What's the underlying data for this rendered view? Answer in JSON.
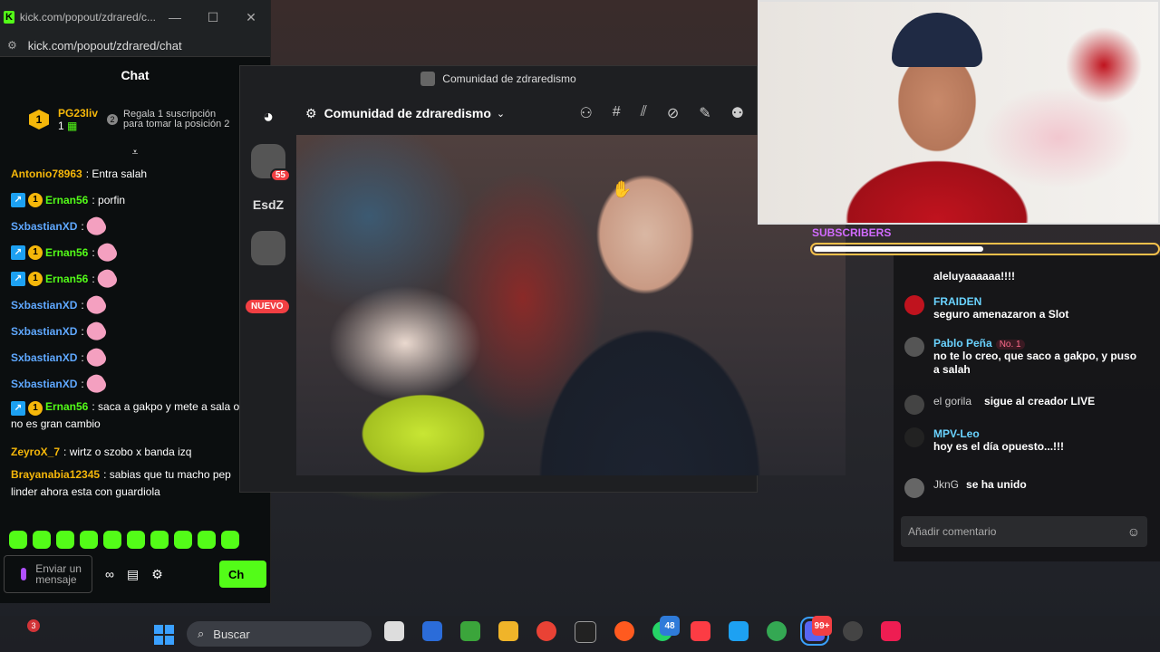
{
  "kick": {
    "tab_title": "kick.com/popout/zdrared/c...",
    "url": "kick.com/popout/zdrared/chat",
    "header": "Chat",
    "pinned": {
      "rank": "1",
      "user": "PG23liv",
      "count": "1",
      "rank2": "2",
      "text": "Regala 1 suscripción para tomar la posición 2"
    },
    "messages": [
      {
        "user": "Antonio78963",
        "text": "Entra salah"
      },
      {
        "user": "Ernan56",
        "text": "porfin"
      },
      {
        "user": "SxbastianXD",
        "text": ""
      },
      {
        "user": "Ernan56",
        "text": ""
      },
      {
        "user": "Ernan56",
        "text": ""
      },
      {
        "user": "SxbastianXD",
        "text": ""
      },
      {
        "user": "SxbastianXD",
        "text": ""
      },
      {
        "user": "SxbastianXD",
        "text": ""
      },
      {
        "user": "SxbastianXD",
        "text": ""
      },
      {
        "user": "Ernan56",
        "text": "saca a gakpo y mete a sala ose no es gran cambio"
      },
      {
        "user": "ZeyroX_7",
        "text": "wirtz o szobo x banda izq"
      },
      {
        "user": "Brayanabia12345",
        "text": "sabias que tu macho pep linder ahora esta con guardiola"
      }
    ],
    "input_placeholder": "Enviar un mensaje",
    "chat_button": "Ch"
  },
  "discord": {
    "window_title": "Comunidad de zdraredismo",
    "server_name": "Comunidad de zdraredismo",
    "servers": [
      {
        "label": "",
        "ping": "55"
      },
      {
        "label": "EsdZ",
        "ping": ""
      },
      {
        "label": "",
        "ping": ""
      }
    ],
    "new_label": "NUEVO"
  },
  "overlay": {
    "subs_label": "SUBSCRIBERS",
    "subs_progress": 0.5
  },
  "live_chat": {
    "items": [
      {
        "user": "",
        "text": "aleluyaaaaaa!!!!"
      },
      {
        "user": "FRAIDEN",
        "text": "seguro amenazaron a Slot"
      },
      {
        "user": "Pablo Peña",
        "tag": "No. 1",
        "text": "no te lo creo, que saco a gakpo, y puso a salah"
      },
      {
        "user": "el gorila",
        "text": "sigue al creador LIVE"
      },
      {
        "user": "MPV-Leo",
        "text": "hoy es el día opuesto...!!!"
      },
      {
        "user": "JknG",
        "text": "se ha unido"
      }
    ],
    "add_comment": "Añadir comentario"
  },
  "taskbar": {
    "notif_count": "3",
    "search": "Buscar",
    "whatsapp_count": "48",
    "discord_count": "99+"
  }
}
